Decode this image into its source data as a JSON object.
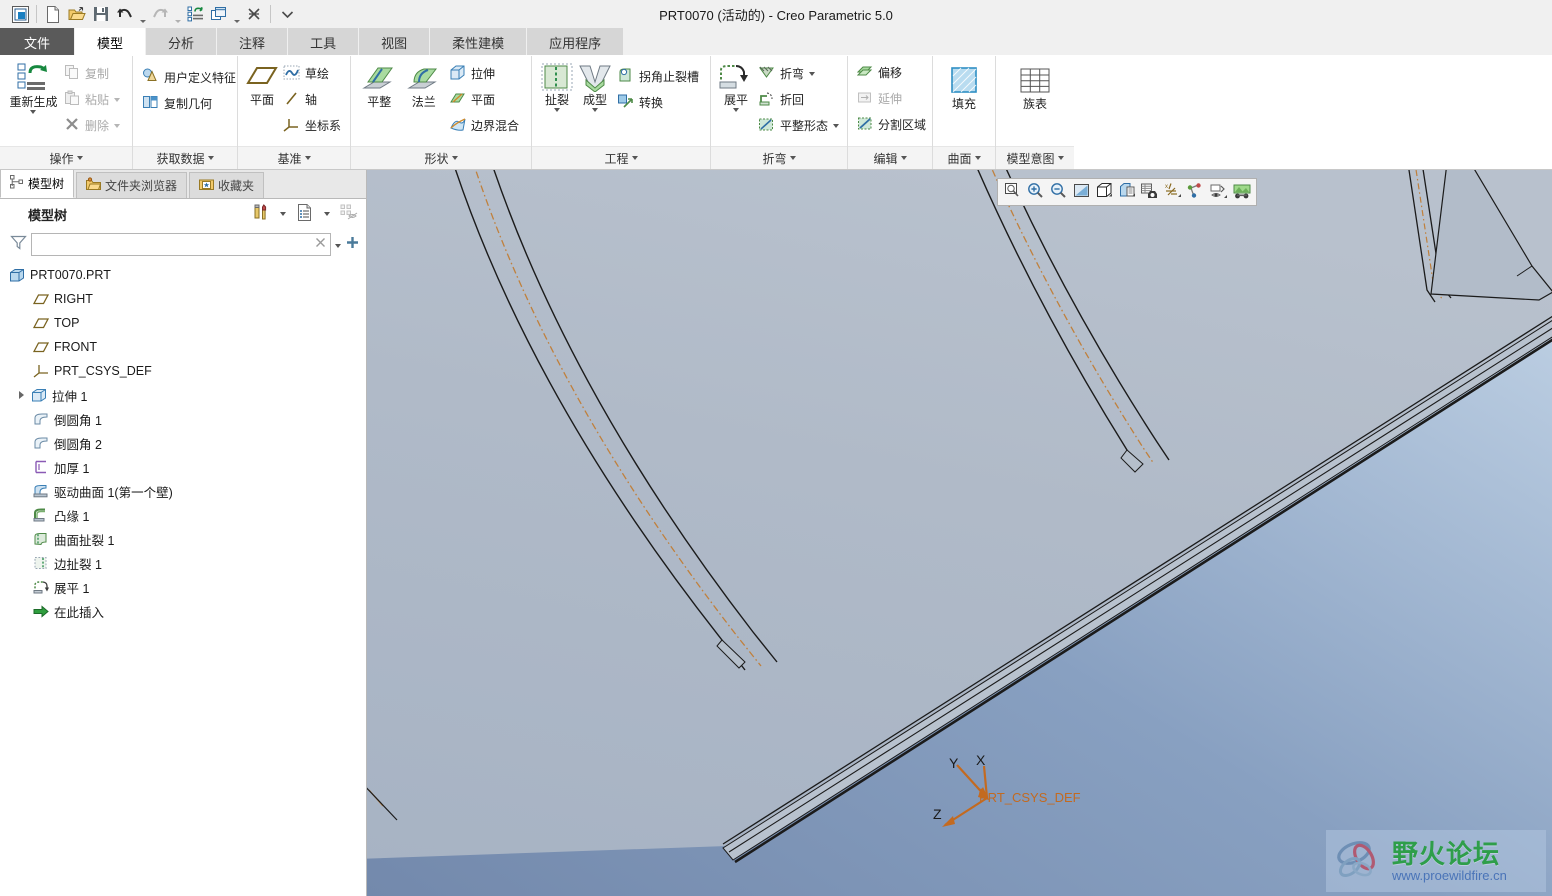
{
  "window": {
    "title": "PRT0070 (活动的) - Creo Parametric 5.0"
  },
  "quick_access": {
    "items": [
      {
        "name": "app-icon",
        "label": "Creo"
      },
      {
        "name": "new-file-button",
        "label": "新建"
      },
      {
        "name": "open-file-button",
        "label": "打开"
      },
      {
        "name": "save-button",
        "label": "保存"
      },
      {
        "name": "undo-button",
        "label": "撤销"
      },
      {
        "name": "redo-button",
        "label": "重做"
      },
      {
        "name": "regenerate-button",
        "label": "重新生成"
      },
      {
        "name": "window-button",
        "label": "窗口"
      },
      {
        "name": "close-button",
        "label": "关闭"
      },
      {
        "name": "customize-qat-button",
        "label": "自定义快速访问工具栏"
      }
    ]
  },
  "tabs": [
    {
      "label": "文件",
      "kind": "file"
    },
    {
      "label": "模型",
      "kind": "active"
    },
    {
      "label": "分析",
      "kind": "normal"
    },
    {
      "label": "注释",
      "kind": "normal"
    },
    {
      "label": "工具",
      "kind": "normal"
    },
    {
      "label": "视图",
      "kind": "normal"
    },
    {
      "label": "柔性建模",
      "kind": "normal"
    },
    {
      "label": "应用程序",
      "kind": "normal"
    }
  ],
  "ribbon": {
    "groups": [
      {
        "name": "operations",
        "title": "操作",
        "big": [
          {
            "label": "重新生成",
            "icon": "regenerate-icon",
            "dropdown": true
          }
        ],
        "small": [
          {
            "label": "复制",
            "icon": "copy-icon",
            "disabled": true,
            "dropdown": false
          },
          {
            "label": "粘贴",
            "icon": "paste-icon",
            "disabled": true,
            "dropdown": true
          },
          {
            "label": "删除",
            "icon": "delete-icon",
            "disabled": true,
            "dropdown": true
          }
        ]
      },
      {
        "name": "get-data",
        "title": "获取数据",
        "big": [],
        "small": [
          {
            "label": "用户定义特征",
            "icon": "udf-icon",
            "disabled": false,
            "dropdown": false
          },
          {
            "label": "复制几何",
            "icon": "copy-geometry-icon",
            "disabled": false,
            "dropdown": false
          }
        ]
      },
      {
        "name": "datum",
        "title": "基准",
        "big": [
          {
            "label": "平面",
            "icon": "datum-plane-icon",
            "dropdown": false
          }
        ],
        "small": [
          {
            "label": "草绘",
            "icon": "sketch-icon",
            "disabled": false,
            "dropdown": false
          },
          {
            "label": "轴",
            "icon": "datum-axis-icon",
            "disabled": false,
            "dropdown": false
          },
          {
            "label": "坐标系",
            "icon": "datum-csys-icon",
            "disabled": false,
            "dropdown": false
          }
        ]
      },
      {
        "name": "shape",
        "title": "形状",
        "big": [
          {
            "label": "平整",
            "icon": "planar-wall-icon",
            "dropdown": false
          },
          {
            "label": "法兰",
            "icon": "flange-wall-icon",
            "dropdown": false
          }
        ],
        "small": [
          {
            "label": "拉伸",
            "icon": "extrude-icon",
            "disabled": false,
            "dropdown": false
          },
          {
            "label": "平面",
            "icon": "flat-surface-icon",
            "disabled": false,
            "dropdown": false
          },
          {
            "label": "边界混合",
            "icon": "boundary-blend-icon",
            "disabled": false,
            "dropdown": false
          }
        ]
      },
      {
        "name": "engineering",
        "title": "工程",
        "big": [
          {
            "label": "扯裂",
            "icon": "rip-icon",
            "dropdown": true
          },
          {
            "label": "成型",
            "icon": "form-icon",
            "dropdown": true
          }
        ],
        "small": [
          {
            "label": "拐角止裂槽",
            "icon": "corner-relief-icon",
            "disabled": false,
            "dropdown": false
          },
          {
            "label": "转换",
            "icon": "conversion-icon",
            "disabled": false,
            "dropdown": false
          }
        ]
      },
      {
        "name": "bend",
        "title": "折弯",
        "big": [
          {
            "label": "展平",
            "icon": "unbend-icon",
            "dropdown": true
          }
        ],
        "small": [
          {
            "label": "折弯",
            "icon": "bend-icon",
            "disabled": false,
            "dropdown": true
          },
          {
            "label": "折回",
            "icon": "bend-back-icon",
            "disabled": false,
            "dropdown": false
          },
          {
            "label": "平整形态",
            "icon": "flat-state-icon",
            "disabled": false,
            "dropdown": true
          }
        ]
      },
      {
        "name": "edit",
        "title": "编辑",
        "big": [],
        "small": [
          {
            "label": "偏移",
            "icon": "offset-icon",
            "disabled": false,
            "dropdown": false
          },
          {
            "label": "延伸",
            "icon": "extend-icon",
            "disabled": true,
            "dropdown": false
          },
          {
            "label": "分割区域",
            "icon": "split-area-icon",
            "disabled": false,
            "dropdown": false
          }
        ]
      },
      {
        "name": "surface",
        "title": "曲面",
        "big": [
          {
            "label": "填充",
            "icon": "fill-icon",
            "dropdown": false
          }
        ],
        "small": []
      },
      {
        "name": "model-intent",
        "title": "模型意图",
        "big": [
          {
            "label": "族表",
            "icon": "family-table-icon",
            "dropdown": false
          }
        ],
        "small": []
      }
    ]
  },
  "nav_panel": {
    "tabs": [
      {
        "label": "模型树",
        "icon": "model-tree-icon",
        "active": true
      },
      {
        "label": "文件夹浏览器",
        "icon": "folder-browser-icon",
        "active": false
      },
      {
        "label": "收藏夹",
        "icon": "favorites-icon",
        "active": false
      }
    ],
    "header_title": "模型树",
    "header_tools": [
      {
        "name": "settings-tools-button",
        "icon": "tools-icon"
      },
      {
        "name": "settings-tools-dropdown",
        "icon": "chevron-down-icon"
      },
      {
        "name": "display-list-button",
        "icon": "list-display-icon"
      },
      {
        "name": "display-list-dropdown",
        "icon": "chevron-down-icon"
      },
      {
        "name": "tree-filter-toggle-button",
        "icon": "tree-hide-icon"
      }
    ],
    "search": {
      "value": "",
      "placeholder": "",
      "filter_icon": "funnel-icon",
      "clear_icon": "clear-x-icon",
      "dropdown_icon": "chevron-down-icon",
      "add_icon": "plus-icon"
    },
    "tree": [
      {
        "label": "PRT0070.PRT",
        "icon": "part-icon",
        "indent": 0,
        "expander": false
      },
      {
        "label": "RIGHT",
        "icon": "datum-plane-icon",
        "indent": 1,
        "expander": false
      },
      {
        "label": "TOP",
        "icon": "datum-plane-icon",
        "indent": 1,
        "expander": false
      },
      {
        "label": "FRONT",
        "icon": "datum-plane-icon",
        "indent": 1,
        "expander": false
      },
      {
        "label": "PRT_CSYS_DEF",
        "icon": "datum-csys-icon",
        "indent": 1,
        "expander": false
      },
      {
        "label": "拉伸 1",
        "icon": "extrude-feature-icon",
        "indent": 1,
        "expander": true
      },
      {
        "label": "倒圆角 1",
        "icon": "round-icon",
        "indent": 1,
        "expander": false
      },
      {
        "label": "倒圆角 2",
        "icon": "round-icon",
        "indent": 1,
        "expander": false
      },
      {
        "label": "加厚 1",
        "icon": "thicken-icon",
        "indent": 1,
        "expander": false
      },
      {
        "label": "驱动曲面 1(第一个壁)",
        "icon": "driving-surface-icon",
        "indent": 1,
        "expander": false
      },
      {
        "label": "凸缘 1",
        "icon": "flange-icon",
        "indent": 1,
        "expander": false
      },
      {
        "label": "曲面扯裂 1",
        "icon": "surface-rip-icon",
        "indent": 1,
        "expander": false
      },
      {
        "label": "边扯裂 1",
        "icon": "edge-rip-icon",
        "indent": 1,
        "expander": false
      },
      {
        "label": "展平 1",
        "icon": "unbend-feature-icon",
        "indent": 1,
        "expander": false
      },
      {
        "label": "在此插入",
        "icon": "insert-here-icon",
        "indent": 1,
        "expander": false
      }
    ]
  },
  "graphics_toolbar": {
    "items": [
      {
        "name": "zoom-to-fit-button",
        "icon": "refit-icon"
      },
      {
        "name": "zoom-in-button",
        "icon": "zoom-in-icon"
      },
      {
        "name": "zoom-out-button",
        "icon": "zoom-out-icon"
      },
      {
        "name": "repaint-button",
        "icon": "repaint-icon"
      },
      {
        "name": "display-style-button",
        "icon": "display-style-cube-icon"
      },
      {
        "name": "saved-orientations-button",
        "icon": "saved-views-icon"
      },
      {
        "name": "view-manager-button",
        "icon": "view-manager-camera-icon"
      },
      {
        "name": "datum-display-button",
        "icon": "datum-display-icon"
      },
      {
        "name": "annotation-display-button",
        "icon": "annotation-display-icon"
      },
      {
        "name": "spin-center-button",
        "icon": "spin-center-icon"
      },
      {
        "name": "appearance-gallery-button",
        "icon": "appearance-gallery-icon"
      }
    ]
  },
  "viewport": {
    "csys": {
      "label": "PRT_CSYS_DEF",
      "axes": [
        "X",
        "Y",
        "Z"
      ],
      "color": "#c36a20"
    },
    "background": {
      "top_color": "#b9cbe0",
      "bottom_color": "#7b94b8"
    },
    "model": {
      "face_color": "#aeb9c9",
      "edge_color": "#1b1b1b",
      "bend_line_color": "#c08040",
      "description": "钣金件展平视图"
    }
  },
  "watermark": {
    "brand": "野火论坛",
    "url": "www.proewildfire.cn",
    "brand_color": "#2e9e4a",
    "url_color": "#4a74b8"
  }
}
